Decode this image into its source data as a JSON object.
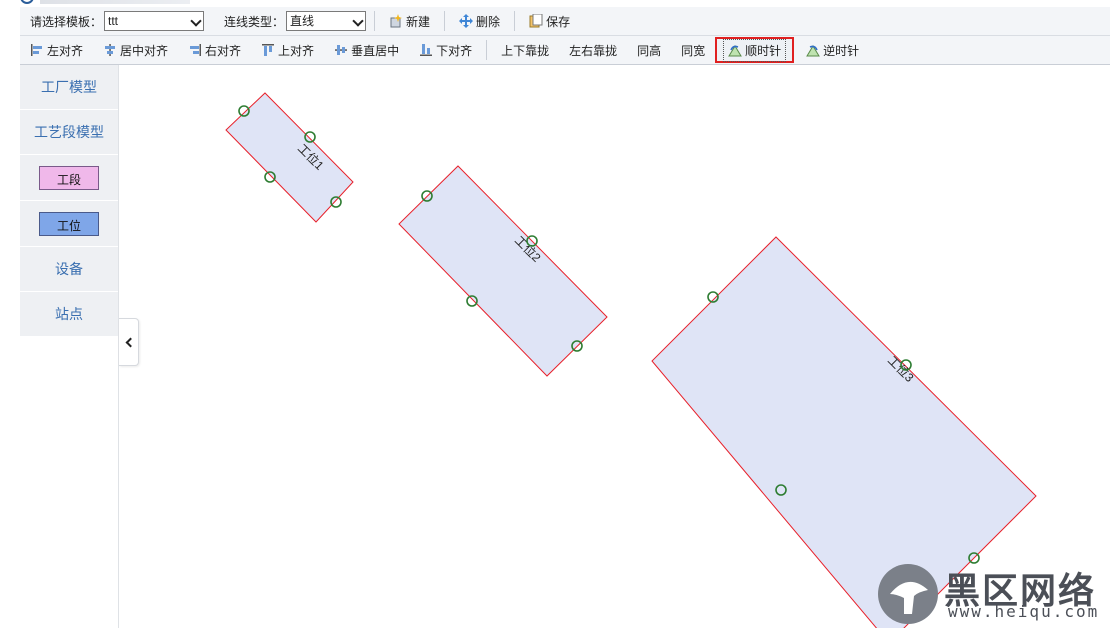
{
  "toolbar_top": {
    "template_label": "请选择模板：",
    "template_value": "ttt",
    "line_type_label": "连线类型：",
    "line_type_value": "直线",
    "new_label": "新建",
    "delete_label": "删除",
    "save_label": "保存"
  },
  "toolbar_align": {
    "align_left": "左对齐",
    "align_center": "居中对齐",
    "align_right": "右对齐",
    "align_top": "上对齐",
    "align_middle": "垂直居中",
    "align_bottom": "下对齐",
    "vertical_distribute": "上下靠拢",
    "horizontal_distribute": "左右靠拢",
    "same_height": "同高",
    "same_width": "同宽",
    "rotate_clockwise": "顺时针",
    "rotate_counterclockwise": "逆时针"
  },
  "sidebar": {
    "factory_model": "工厂模型",
    "process_model": "工艺段模型",
    "segment": "工段",
    "position": "工位",
    "equipment": "设备",
    "station": "站点"
  },
  "canvas": {
    "shapes": [
      {
        "label": "工位1"
      },
      {
        "label": "工位2"
      },
      {
        "label": "工位3"
      }
    ]
  },
  "watermark": {
    "name": "黑区网络",
    "url": "www.heiqu.com"
  },
  "colors": {
    "shape_fill": "#dfe4f6",
    "shape_border": "#e8202a",
    "port": "#2e7d32",
    "accent_blue": "#3a6fb0",
    "highlight_red": "#e02020"
  }
}
